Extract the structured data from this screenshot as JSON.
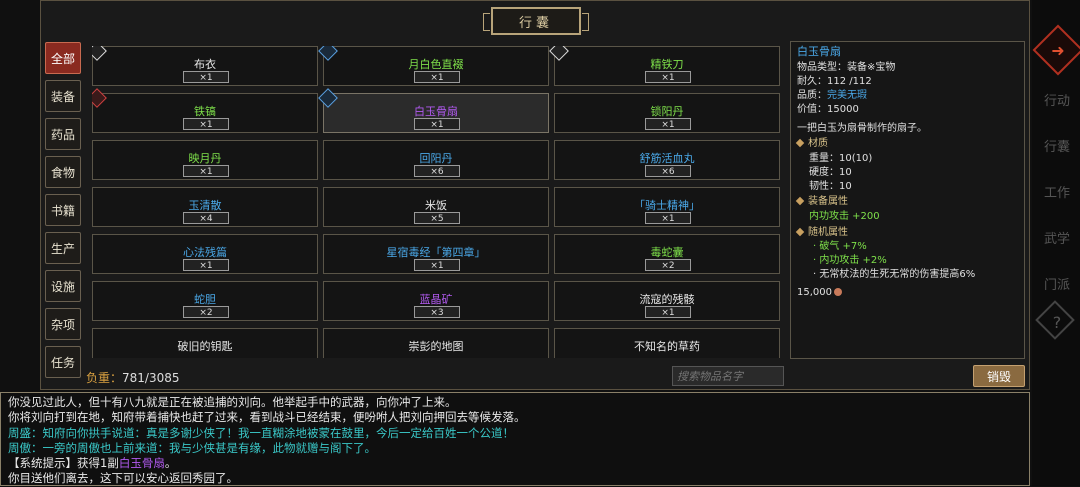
{
  "panel_title": "行囊",
  "categories": [
    {
      "label": "全部",
      "active": true
    },
    {
      "label": "装备",
      "active": false
    },
    {
      "label": "药品",
      "active": false
    },
    {
      "label": "食物",
      "active": false
    },
    {
      "label": "书籍",
      "active": false
    },
    {
      "label": "生产",
      "active": false
    },
    {
      "label": "设施",
      "active": false
    },
    {
      "label": "杂项",
      "active": false
    },
    {
      "label": "任务",
      "active": false
    }
  ],
  "items": [
    {
      "name": "布衣",
      "qty": "×1",
      "color": "white",
      "badge": "white",
      "selected": false
    },
    {
      "name": "月白色直裰",
      "qty": "×1",
      "color": "green",
      "badge": "blue",
      "selected": false
    },
    {
      "name": "精铁刀",
      "qty": "×1",
      "color": "green",
      "badge": "white",
      "selected": false
    },
    {
      "name": "铁镐",
      "qty": "×1",
      "color": "green",
      "badge": "red",
      "selected": false
    },
    {
      "name": "白玉骨扇",
      "qty": "×1",
      "color": "purple",
      "badge": "blue",
      "selected": true
    },
    {
      "name": "锁阳丹",
      "qty": "×1",
      "color": "green",
      "badge": "",
      "selected": false
    },
    {
      "name": "映月丹",
      "qty": "×1",
      "color": "green",
      "badge": "",
      "selected": false
    },
    {
      "name": "回阳丹",
      "qty": "×6",
      "color": "blue",
      "badge": "",
      "selected": false
    },
    {
      "name": "舒筋活血丸",
      "qty": "×6",
      "color": "blue",
      "badge": "",
      "selected": false
    },
    {
      "name": "玉清散",
      "qty": "×4",
      "color": "blue",
      "badge": "",
      "selected": false
    },
    {
      "name": "米饭",
      "qty": "×5",
      "color": "white",
      "badge": "",
      "selected": false
    },
    {
      "name": "「骑士精神」",
      "qty": "×1",
      "color": "blue",
      "badge": "",
      "selected": false
    },
    {
      "name": "心法残篇",
      "qty": "×1",
      "color": "blue",
      "badge": "",
      "selected": false
    },
    {
      "name": "星宿毒经「第四章」",
      "qty": "×1",
      "color": "blue",
      "badge": "",
      "selected": false
    },
    {
      "name": "毒蛇囊",
      "qty": "×2",
      "color": "green",
      "badge": "",
      "selected": false
    },
    {
      "name": "蛇胆",
      "qty": "×2",
      "color": "blue",
      "badge": "",
      "selected": false
    },
    {
      "name": "蓝晶矿",
      "qty": "×3",
      "color": "purple",
      "badge": "",
      "selected": false
    },
    {
      "name": "流寇的残骸",
      "qty": "×1",
      "color": "white",
      "badge": "",
      "selected": false
    },
    {
      "name": "破旧的钥匙",
      "qty": "",
      "color": "white",
      "badge": "",
      "selected": false
    },
    {
      "name": "崇彭的地图",
      "qty": "",
      "color": "white",
      "badge": "",
      "selected": false
    },
    {
      "name": "不知名的草药",
      "qty": "",
      "color": "white",
      "badge": "",
      "selected": false
    }
  ],
  "weight": {
    "label": "负重：",
    "value": "781/3085"
  },
  "search": {
    "placeholder": "搜索物品名字"
  },
  "destroy_label": "销毁",
  "detail": {
    "name": "白玉骨扇",
    "type_label": "物品类型：",
    "type_value": "装备※宝物",
    "durability_label": "耐久：",
    "durability_value": "112 /112",
    "quality_label": "品质：",
    "quality_value": "完美无瑕",
    "price_label": "价值：",
    "price_value": "15000",
    "description": "一把白玉为扇骨制作的扇子。",
    "material_title": "材质",
    "weight_line": "重量：10(10)",
    "hardness_line": "硬度：10",
    "toughness_line": "韧性：10",
    "equip_title": "装备属性",
    "equip_attr": "内功攻击 +200",
    "random_title": "随机属性",
    "random_1": "· 破气 +7%",
    "random_2": "· 内功攻击 +2%",
    "random_3": "· 无常杖法的生死无常的伤害提高6%",
    "sell_price": "15,000"
  },
  "log": [
    {
      "text": "你没见过此人，但十有八九就是正在被追捕的刘向。他举起手中的武器，向你冲了上来。",
      "color": "white"
    },
    {
      "text": "你将刘向打到在地，知府带着捕快也赶了过来，看到战斗已经结束，便吩咐人把刘向押回去等候发落。",
      "color": "white"
    },
    {
      "text": "周盛：知府向你拱手说道：真是多谢少侠了！我一直糊涂地被蒙在鼓里，今后一定给百姓一个公道！",
      "color": "cyan"
    },
    {
      "text": "周傲：一旁的周傲也上前来道：我与少侠甚是有缘，此物就赠与阁下了。",
      "color": "cyan"
    },
    {
      "text_prefix": "【系统提示】获得1副",
      "text_item": "白玉骨扇",
      "text_suffix": "。",
      "color": "mixed"
    },
    {
      "text": "你目送他们离去，这下可以安心返回秀园了。",
      "color": "white"
    }
  ],
  "side_buttons": [
    "行动",
    "行囊",
    "工作",
    "武学",
    "门派"
  ],
  "side_icons": {
    "top": "arrow-icon",
    "help": "help-icon"
  }
}
